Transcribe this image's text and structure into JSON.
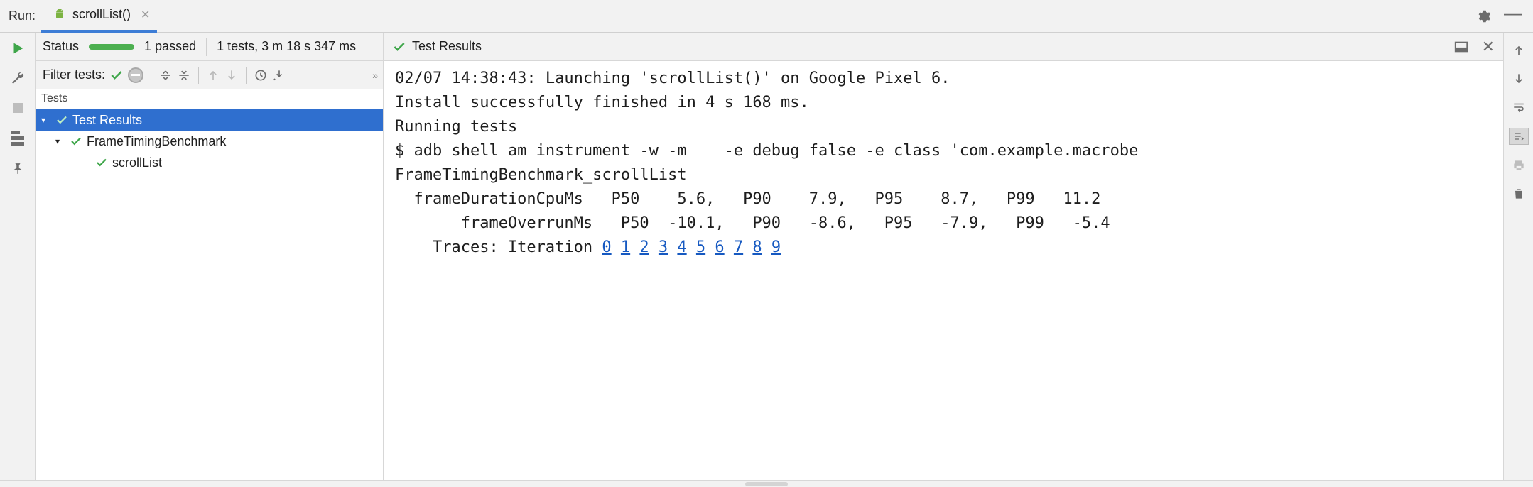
{
  "run": {
    "label": "Run:",
    "tab_name": "scrollList()"
  },
  "status": {
    "label": "Status",
    "passed": "1 passed",
    "summary": "1 tests, 3 m 18 s 347 ms"
  },
  "filter": {
    "label": "Filter tests:"
  },
  "tests_header": "Tests",
  "tree": {
    "root": "Test Results",
    "suite": "FrameTimingBenchmark",
    "case": "scrollList"
  },
  "right": {
    "title": "Test Results"
  },
  "console": {
    "l1": "02/07 14:38:43: Launching 'scrollList()' on Google Pixel 6.",
    "l2": "Install successfully finished in 4 s 168 ms.",
    "l3": "Running tests",
    "l4": "",
    "l5": "$ adb shell am instrument -w -m    -e debug false -e class 'com.example.macrobe",
    "l6": "",
    "l7": "FrameTimingBenchmark_scrollList",
    "l8": "  frameDurationCpuMs   P50    5.6,   P90    7.9,   P95    8.7,   P99   11.2",
    "l9": "       frameOverrunMs   P50  -10.1,   P90   -8.6,   P95   -7.9,   P99   -5.4",
    "traces_label": "    Traces: Iteration ",
    "iterations": [
      "0",
      "1",
      "2",
      "3",
      "4",
      "5",
      "6",
      "7",
      "8",
      "9"
    ]
  }
}
